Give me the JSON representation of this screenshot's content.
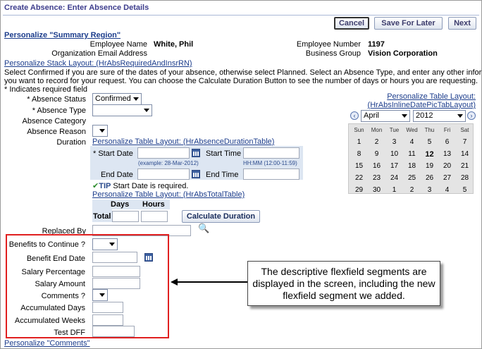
{
  "page": {
    "title": "Create Absence: Enter Absence Details"
  },
  "buttons": {
    "cancel": "Cancel",
    "save_for_later": "Save For Later",
    "next": "Next",
    "calculate_duration": "Calculate Duration"
  },
  "personalize": {
    "summary_region": "Personalize \"Summary Region\"",
    "stack_layout": "Personalize Stack Layout: (HrAbsRequiredAndInsrRN)",
    "table_layout_1": "Personalize Table Layout:",
    "table_layout_1b": "(HrAbsInlineDatePicTabLayout)",
    "duration_table": "Personalize Table Layout: (HrAbsenceDurationTable)",
    "total_table": "Personalize Table Layout: (HrAbsTotalTable)",
    "comments": "Personalize \"Comments\""
  },
  "summary": {
    "employee_name_label": "Employee Name",
    "employee_name": "White, Phil",
    "employee_number_label": "Employee Number",
    "employee_number": "1197",
    "org_email_label": "Organization Email Address",
    "business_group_label": "Business Group",
    "business_group": "Vision Corporation"
  },
  "instructions": {
    "line1": "Select Confirmed if you are sure of the dates of your absence, otherwise select Planned. Select an Absence Type, and enter any other information",
    "line2": "you want to record for your request. You can choose the Calculate Duration Button to see the number of days or hours you are requesting.",
    "required": "* Indicates required field"
  },
  "form": {
    "absence_status_label": "* Absence Status",
    "absence_status_value": "Confirmed",
    "absence_type_label": "* Absence Type",
    "absence_category_label": "Absence Category",
    "absence_reason_label": "Absence Reason",
    "duration_label": "Duration",
    "start_date_label": "* Start Date",
    "start_time_label": "Start Time",
    "date_example": "(example: 28-Mar-2012)",
    "time_example": "HH:MM (12:00-11:59)",
    "end_date_label": "End Date",
    "end_time_label": "End Time",
    "tip_label": "TIP",
    "tip_text": "Start Date is required.",
    "days_label": "Days",
    "hours_label": "Hours",
    "total_label": "Total",
    "replaced_by_label": "Replaced By"
  },
  "flex": {
    "benefits_to_continue": "Benefits to Continue ?",
    "benefit_end_date": "Benefit End Date",
    "salary_percentage": "Salary Percentage",
    "salary_amount": "Salary Amount",
    "comments": "Comments ?",
    "accumulated_days": "Accumulated Days",
    "accumulated_weeks": "Accumulated Weeks",
    "test_dff": "Test DFF"
  },
  "calendar": {
    "month": "April",
    "year": "2012",
    "days": [
      "Sun",
      "Mon",
      "Tue",
      "Wed",
      "Thu",
      "Fri",
      "Sat"
    ],
    "weeks": [
      [
        "1",
        "2",
        "3",
        "4",
        "5",
        "6",
        "7"
      ],
      [
        "8",
        "9",
        "10",
        "11",
        "12",
        "13",
        "14"
      ],
      [
        "15",
        "16",
        "17",
        "18",
        "19",
        "20",
        "21"
      ],
      [
        "22",
        "23",
        "24",
        "25",
        "26",
        "27",
        "28"
      ],
      [
        "29",
        "30",
        "1",
        "2",
        "3",
        "4",
        "5"
      ]
    ],
    "today": "12"
  },
  "callout": {
    "text": "The descriptive flexfield segments are displayed in the screen, including the new flexfield segment we added."
  }
}
